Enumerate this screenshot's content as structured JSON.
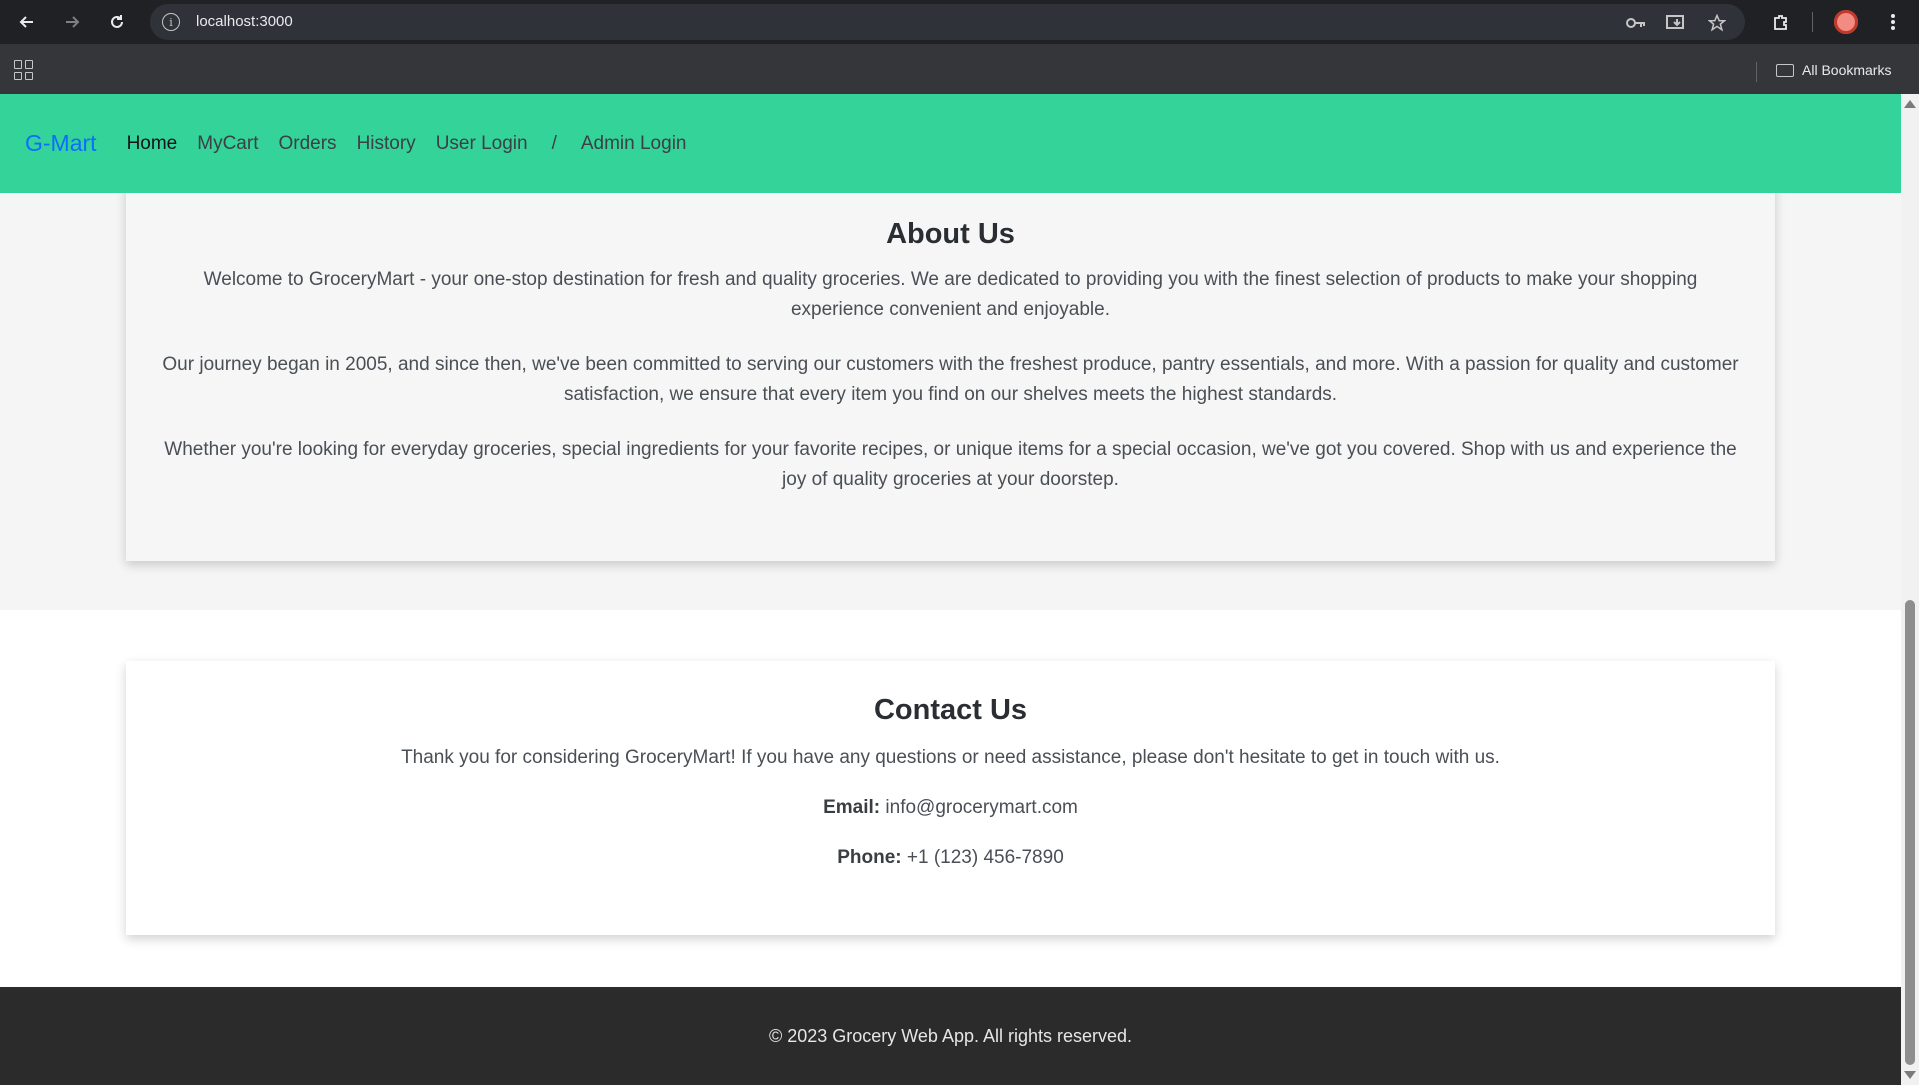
{
  "browser": {
    "url": "localhost:3000",
    "bookmarks_label": "All Bookmarks",
    "icons": {
      "back": "arrow-left-icon",
      "forward": "arrow-right-icon",
      "reload": "reload-icon",
      "site_info": "info-icon",
      "password": "key-icon",
      "install": "install-icon",
      "bookmark": "star-icon",
      "extensions": "puzzle-icon",
      "menu": "kebab-menu-icon",
      "apps": "apps-grid-icon",
      "folder": "folder-icon"
    }
  },
  "navbar": {
    "brand": "G-Mart",
    "links": [
      "Home",
      "MyCart",
      "Orders",
      "History",
      "User Login"
    ],
    "separator": "/",
    "admin_link": "Admin Login",
    "colors": {
      "background": "#34d399",
      "brand": "#0d6efd"
    }
  },
  "about": {
    "title": "About Us",
    "paragraphs": [
      "Welcome to GroceryMart - your one-stop destination for fresh and quality groceries. We are dedicated to providing you with the finest selection of products to make your shopping experience convenient and enjoyable.",
      "Our journey began in 2005, and since then, we've been committed to serving our customers with the freshest produce, pantry essentials, and more. With a passion for quality and customer satisfaction, we ensure that every item you find on our shelves meets the highest standards.",
      "Whether you're looking for everyday groceries, special ingredients for your favorite recipes, or unique items for a special occasion, we've got you covered. Shop with us and experience the joy of quality groceries at your doorstep."
    ]
  },
  "contact": {
    "title": "Contact Us",
    "intro": "Thank you for considering GroceryMart! If you have any questions or need assistance, please don't hesitate to get in touch with us.",
    "email_label": "Email:",
    "email_value": "info@grocerymart.com",
    "phone_label": "Phone:",
    "phone_value": "+1 (123) 456-7890"
  },
  "footer": {
    "text": "© 2023 Grocery Web App. All rights reserved."
  }
}
